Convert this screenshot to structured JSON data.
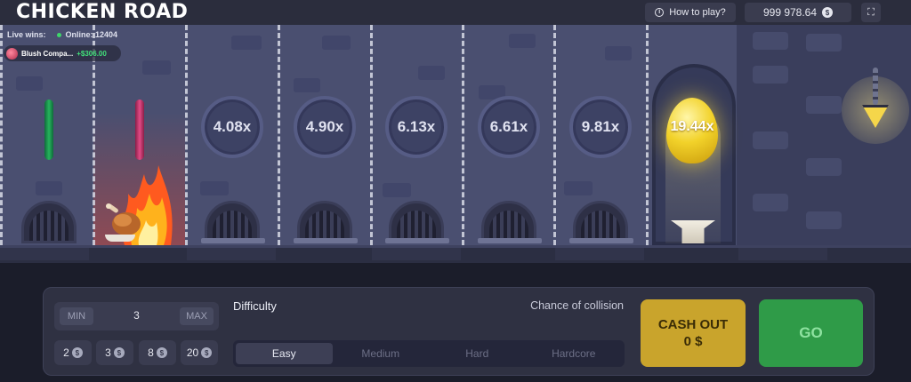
{
  "header": {
    "logo": "CHICKEN ROAD",
    "how_to_play": "How to play?",
    "balance": "999 978.64",
    "currency_symbol": "$"
  },
  "live": {
    "label": "Live wins:",
    "online_label": "Online:",
    "online_count": "12404",
    "latest_win": {
      "player": "Blush Compa...",
      "amount": "+$306.00"
    }
  },
  "multipliers": [
    "4.08x",
    "4.90x",
    "6.13x",
    "6.61x",
    "9.81x",
    "19.44x"
  ],
  "bet": {
    "min_label": "MIN",
    "max_label": "MAX",
    "value": "3",
    "chips": [
      "2",
      "3",
      "8",
      "20"
    ]
  },
  "difficulty": {
    "label": "Difficulty",
    "collision_label": "Chance of collision",
    "options": [
      "Easy",
      "Medium",
      "Hard",
      "Hardcore"
    ],
    "selected": "Easy"
  },
  "actions": {
    "cashout_label": "CASH OUT",
    "cashout_amount": "0 $",
    "go_label": "GO"
  },
  "colors": {
    "accent_gold": "#c9a42c",
    "go_green": "#2f9b48",
    "win_green": "#42e07a",
    "scene_bg": "#4a4f70"
  }
}
